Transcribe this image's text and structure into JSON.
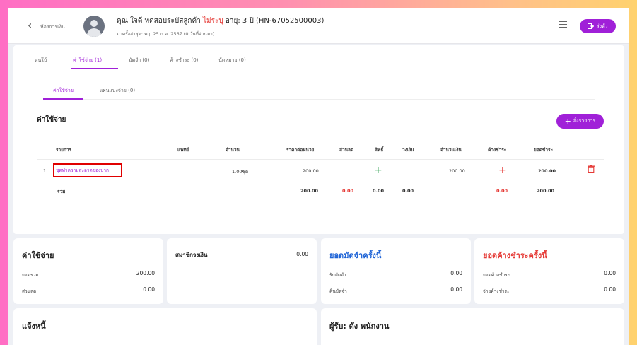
{
  "header": {
    "back_label": "ห้องการเงิน",
    "patient_name_prefix": "คุณ ใจดี ทดสอบระบัสลูกค้า",
    "insurance_status": "ไม่ระบุ",
    "age_and_hn": "อายุ: 3 ปี (HN-67052500003)",
    "last_visit": "มาครั้งล่าสุด: พฤ. 25 ก.ค. 2567 (0 วันที่ผ่านมา)",
    "send_label": "ส่งตัว"
  },
  "tabs_primary": [
    {
      "label": "ตนใบ้"
    },
    {
      "label": "ค่าใช้จ่าย (1)"
    },
    {
      "label": "มัดจำ (0)"
    },
    {
      "label": "ค้างชำระ (0)"
    },
    {
      "label": "นัดหมาย (0)"
    }
  ],
  "tabs_secondary": [
    {
      "label": "ค่าใช้จ่าย"
    },
    {
      "label": "แผนแบ่งจ่าย (0)"
    }
  ],
  "section_title": "ค่าใช้จ่าย",
  "add_button_label": "สั่งรายการ",
  "table": {
    "headers": {
      "item": "รายการ",
      "doctor": "แพทย์",
      "qty": "จำนวน",
      "unit_price": "ราคาต่อหน่วย",
      "discount": "ส่วนลด",
      "rights": "สิทธิ์",
      "credit": "วงเงิน",
      "amount": "จำนวนเงิน",
      "outstanding": "ค้างชำระ",
      "net": "ยอดชำระ"
    },
    "rows": [
      {
        "no": "1",
        "item": "ชุดทำความสะอาดช่องปาก",
        "qty": "1.00ชุด",
        "unit_price": "200.00",
        "amount": "200.00",
        "net": "200.00"
      }
    ],
    "total": {
      "label": "รวม",
      "unit_price": "200.00",
      "discount": "0.00",
      "rights": "0.00",
      "credit": "0.00",
      "outstanding": "0.00",
      "net": "200.00"
    }
  },
  "summary_expense": {
    "title": "ค่าใช้จ่าย",
    "rows": [
      {
        "label": "ยอดรวม",
        "value": "200.00"
      },
      {
        "label": "ส่วนลด",
        "value": "0.00"
      }
    ]
  },
  "summary_member": {
    "title": "สมาชิกวงเงิน",
    "value": "0.00"
  },
  "summary_deposit": {
    "title": "ยอดมัดจำครั้งนี้",
    "rows": [
      {
        "label": "รับมัดจำ",
        "value": "0.00"
      },
      {
        "label": "คืนมัดจำ",
        "value": "0.00"
      }
    ]
  },
  "summary_outstanding": {
    "title": "ยอดค้างชำระครั้งนี้",
    "rows": [
      {
        "label": "ยอดค้างชำระ",
        "value": "0.00"
      },
      {
        "label": "จ่ายค้างชำระ",
        "value": "0.00"
      }
    ]
  },
  "notify": {
    "title": "แจ้งหนี้"
  },
  "receiver": {
    "title": "ผู้รับ: ดัง พนักงาน"
  },
  "colors": {
    "accent": "#a020d8",
    "red": "#e53935",
    "blue": "#1e63d6",
    "green": "#2e9e4f"
  }
}
